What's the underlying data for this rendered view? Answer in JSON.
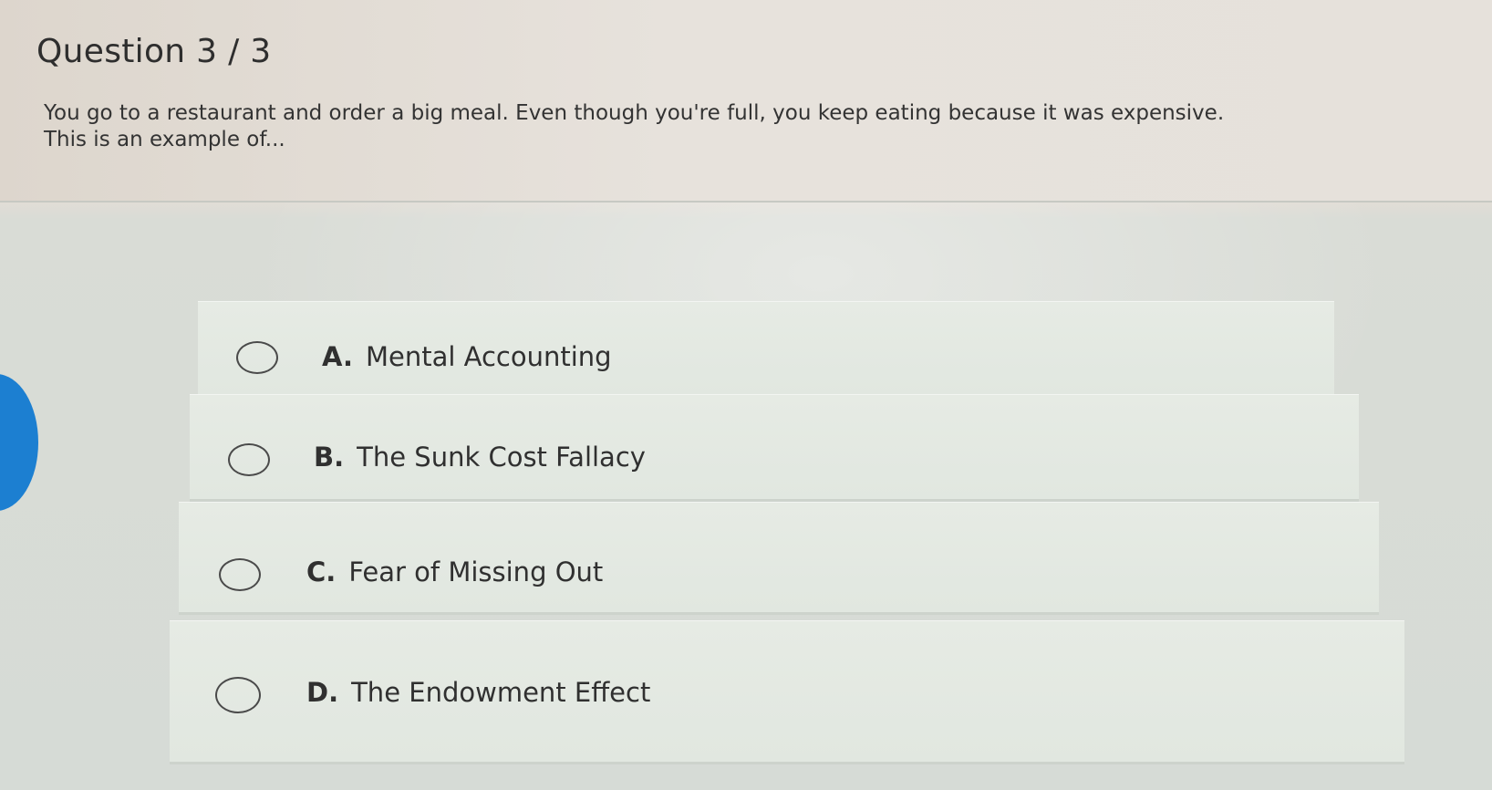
{
  "question": {
    "title": "Question 3 / 3",
    "text": "You go to a restaurant and order a big meal. Even though you're full, you keep eating because it was expensive. This is an example of..."
  },
  "answers": [
    {
      "letter": "A.",
      "text": "Mental Accounting"
    },
    {
      "letter": "B.",
      "text": "The Sunk Cost Fallacy"
    },
    {
      "letter": "C.",
      "text": "Fear of Missing Out"
    },
    {
      "letter": "D.",
      "text": "The Endowment Effect"
    }
  ],
  "colors": {
    "accent": "#1c7fd1",
    "card": "#e3e9e2",
    "text": "#303030"
  },
  "icons": {
    "radio": "radio-unselected-icon"
  }
}
